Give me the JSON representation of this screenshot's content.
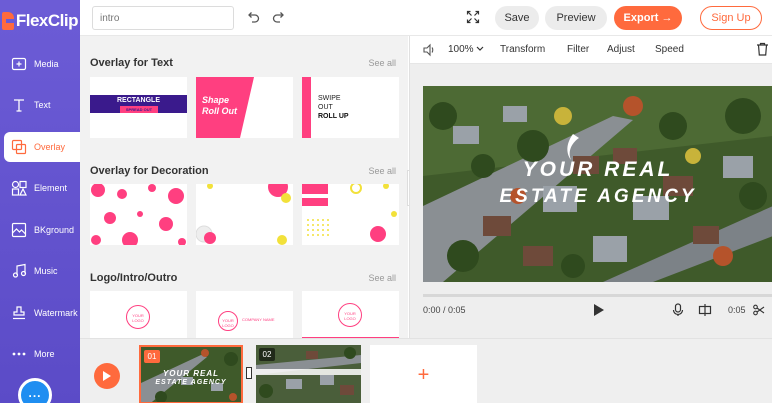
{
  "app": {
    "brand": "FlexClip"
  },
  "topbar": {
    "title_value": "",
    "title_placeholder": "intro",
    "save_label": "Save",
    "preview_label": "Preview",
    "export_label": "Export →",
    "signup_label": "Sign Up"
  },
  "sidebar": {
    "items": [
      {
        "label": "Media",
        "icon": "media-icon"
      },
      {
        "label": "Text",
        "icon": "text-icon"
      },
      {
        "label": "Overlay",
        "icon": "overlay-icon",
        "active": true
      },
      {
        "label": "Element",
        "icon": "element-icon"
      },
      {
        "label": "BKground",
        "icon": "background-icon"
      },
      {
        "label": "Music",
        "icon": "music-icon"
      },
      {
        "label": "Watermark",
        "icon": "watermark-icon"
      },
      {
        "label": "More",
        "icon": "more-icon"
      }
    ],
    "chat_icon": "chat-icon"
  },
  "panel": {
    "sections": [
      {
        "title": "Overlay for Text",
        "see_all": "See all"
      },
      {
        "title": "Overlay for Decoration",
        "see_all": "See all"
      },
      {
        "title": "Logo/Intro/Outro",
        "see_all": "See all"
      }
    ],
    "text_thumbs": {
      "t1_line1": "RECTANGLE",
      "t1_line2": "SPREAD OUT",
      "t2_line1": "Shape",
      "t2_line2": "Roll Out",
      "t3_line1": "SWIPE",
      "t3_line2": "OUT",
      "t3_line3": "ROLL UP"
    },
    "logo_thumbs": {
      "logo_label": "YOUR LOGO",
      "company_label": "COMPANY NAME"
    }
  },
  "editor": {
    "zoom": "100%",
    "tools": [
      "Transform",
      "Filter",
      "Adjust",
      "Speed"
    ],
    "video_line1": "YOUR REAL",
    "video_line2": "ESTATE AGENCY",
    "time_current": "0:00 / 0:05",
    "clip_duration": "0:05",
    "progress_fraction": 0
  },
  "timeline": {
    "clips": [
      {
        "num": "01",
        "line1": "YOUR REAL",
        "line2": "ESTATE AGENCY"
      },
      {
        "num": "02"
      }
    ],
    "add_symbol": "+"
  },
  "colors": {
    "accent": "#ff6a3d",
    "sidebar": "#5b4bc7",
    "pink": "#ff3f80",
    "purple": "#3a1a8c",
    "yellow": "#f2e13a"
  }
}
